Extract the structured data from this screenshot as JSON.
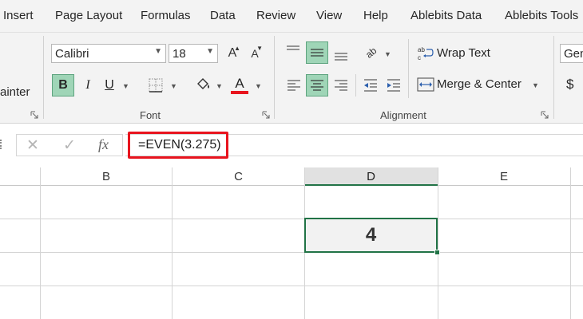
{
  "menu_tabs": [
    "Insert",
    "Page Layout",
    "Formulas",
    "Data",
    "Review",
    "View",
    "Help",
    "Ablebits Data",
    "Ablebits Tools"
  ],
  "ribbon": {
    "clipboard": {
      "painter_label": "ainter"
    },
    "font": {
      "font_name": "Calibri",
      "font_size": "18",
      "group_label": "Font",
      "increase_font": "A",
      "decrease_font": "A",
      "bold": "B",
      "italic": "I",
      "underline": "U",
      "font_color_letter": "A",
      "font_color": "#e8141e"
    },
    "alignment": {
      "wrap_text": "Wrap Text",
      "merge_center": "Merge & Center",
      "orientation_glyph": "ab",
      "group_label": "Alignment"
    },
    "number": {
      "format": "Gen",
      "currency": "$"
    }
  },
  "formula_bar": {
    "cancel": "✕",
    "enter": "✓",
    "fx": "fx",
    "formula": "=EVEN(3.275)"
  },
  "grid": {
    "columns": [
      "B",
      "C",
      "D",
      "E"
    ],
    "selected_column": "D",
    "active_cell_value": "4"
  },
  "colors": {
    "accent_green": "#217346",
    "active_button": "#9fd5b7",
    "highlight_red": "#e8141e"
  }
}
